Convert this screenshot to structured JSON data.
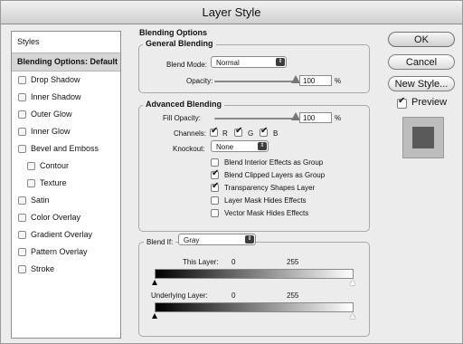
{
  "window": {
    "title": "Layer Style"
  },
  "sidebar": {
    "header": "Styles",
    "selected": "Blending Options: Default",
    "items": [
      {
        "label": "Drop Shadow",
        "sub": false
      },
      {
        "label": "Inner Shadow",
        "sub": false
      },
      {
        "label": "Outer Glow",
        "sub": false
      },
      {
        "label": "Inner Glow",
        "sub": false
      },
      {
        "label": "Bevel and Emboss",
        "sub": false
      },
      {
        "label": "Contour",
        "sub": true
      },
      {
        "label": "Texture",
        "sub": true
      },
      {
        "label": "Satin",
        "sub": false
      },
      {
        "label": "Color Overlay",
        "sub": false
      },
      {
        "label": "Gradient Overlay",
        "sub": false
      },
      {
        "label": "Pattern Overlay",
        "sub": false
      },
      {
        "label": "Stroke",
        "sub": false
      }
    ]
  },
  "blending_options": {
    "title": "Blending Options",
    "general": {
      "title": "General Blending",
      "blend_mode_label": "Blend Mode:",
      "blend_mode_value": "Normal",
      "opacity_label": "Opacity:",
      "opacity_value": "100",
      "opacity_fraction": 1.0,
      "percent": "%"
    },
    "advanced": {
      "title": "Advanced Blending",
      "fill_opacity_label": "Fill Opacity:",
      "fill_opacity_value": "100",
      "fill_opacity_fraction": 1.0,
      "percent": "%",
      "channels_label": "Channels:",
      "channel_r": "R",
      "channel_g": "G",
      "channel_b": "B",
      "knockout_label": "Knockout:",
      "knockout_value": "None",
      "options": [
        {
          "label": "Blend Interior Effects as Group",
          "checked": false
        },
        {
          "label": "Blend Clipped Layers as Group",
          "checked": true
        },
        {
          "label": "Transparency Shapes Layer",
          "checked": true
        },
        {
          "label": "Layer Mask Hides Effects",
          "checked": false
        },
        {
          "label": "Vector Mask Hides Effects",
          "checked": false
        }
      ]
    },
    "blend_if": {
      "label": "Blend If:",
      "value": "Gray",
      "this_layer_label": "This Layer:",
      "this_layer_low": "0",
      "this_layer_high": "255",
      "underlying_label": "Underlying Layer:",
      "underlying_low": "0",
      "underlying_high": "255"
    }
  },
  "buttons": {
    "ok": "OK",
    "cancel": "Cancel",
    "new_style": "New Style...",
    "preview": "Preview"
  },
  "preview_swatch_color": "#5a5a5a"
}
